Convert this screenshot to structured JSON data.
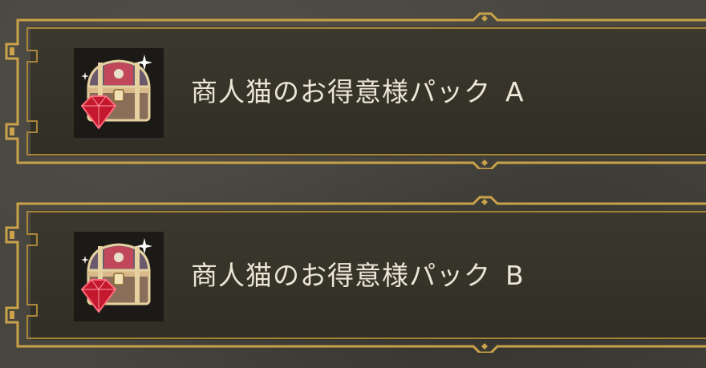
{
  "packs": [
    {
      "name": "商人猫のお得意様パック",
      "variant": "A",
      "icon": "treasure-chest-with-ruby-icon"
    },
    {
      "name": "商人猫のお得意様パック",
      "variant": "B",
      "icon": "treasure-chest-with-ruby-icon"
    }
  ],
  "colors": {
    "background": "#47453e",
    "panel": "#3c3a2e",
    "gold_border": "#c9a24a",
    "text": "#ece6d6"
  }
}
